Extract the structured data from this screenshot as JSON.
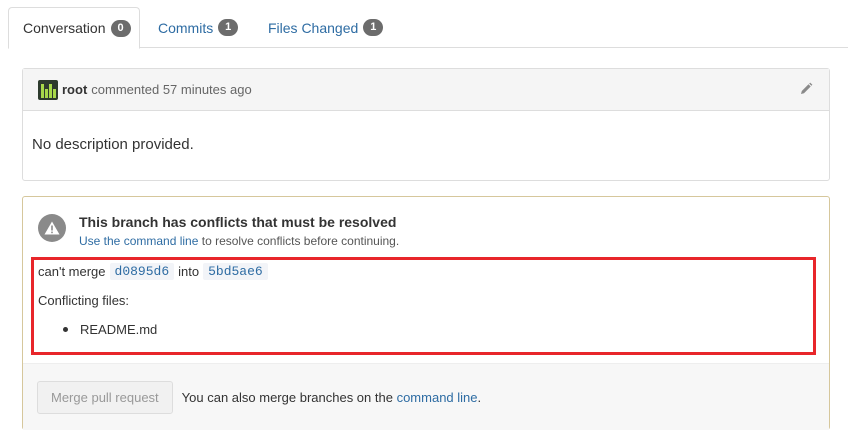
{
  "tabs": [
    {
      "label": "Conversation",
      "count": "0"
    },
    {
      "label": "Commits",
      "count": "1"
    },
    {
      "label": "Files Changed",
      "count": "1"
    }
  ],
  "comment": {
    "author": "root",
    "action": "commented 57 minutes ago",
    "body": "No description provided."
  },
  "merge": {
    "title": "This branch has conflicts that must be resolved",
    "sub_prefix": "Use the",
    "sub_link": "command line",
    "sub_suffix": "to resolve conflicts before continuing.",
    "cant_merge": "can't merge",
    "head_sha": "d0895d6",
    "into": "into",
    "base_sha": "5bd5ae6",
    "conflicting_label": "Conflicting files:",
    "files": [
      "README.md"
    ],
    "button_label": "Merge pull request",
    "footer_prefix": "You can also merge branches on the",
    "footer_link": "command line",
    "footer_suffix": "."
  },
  "colors": {
    "link": "#2e6ca3",
    "badge": "#6c6c6c",
    "highlight": "#e8262a",
    "merge_border": "#d6c79c"
  },
  "icons": [
    "avatar-icon",
    "pencil-icon",
    "warning-icon"
  ]
}
